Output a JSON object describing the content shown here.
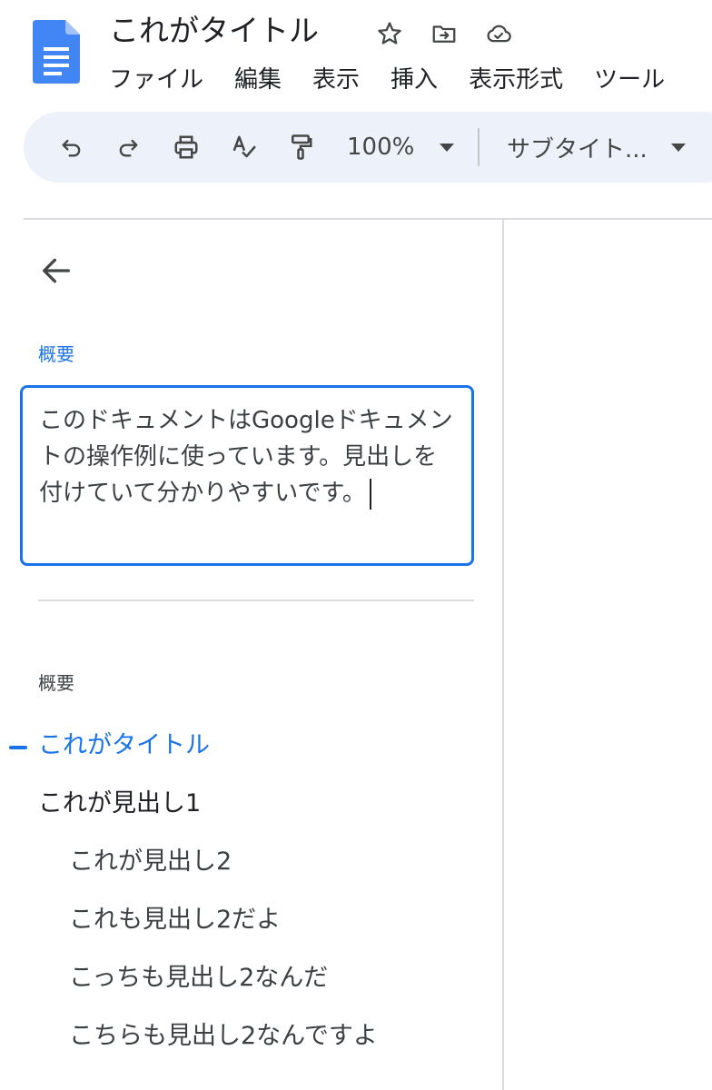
{
  "document": {
    "title": "これがタイトル"
  },
  "title_icons": [
    "star-icon",
    "move-to-folder-icon",
    "cloud-saved-icon"
  ],
  "menu": {
    "items": [
      "ファイル",
      "編集",
      "表示",
      "挿入",
      "表示形式",
      "ツール"
    ]
  },
  "toolbar": {
    "icons": [
      "undo-icon",
      "redo-icon",
      "print-icon",
      "spellcheck-icon",
      "paint-format-icon"
    ],
    "zoom": "100%",
    "style": "サブタイト..."
  },
  "sidebar": {
    "summary_label": "概要",
    "summary_text": "このドキュメントはGoogleドキュメントの操作例に使っています。見出しを付けていて分かりやすいです。",
    "outline_label": "概要",
    "outline": [
      {
        "text": "これがタイトル",
        "level": "title",
        "active": true
      },
      {
        "text": "これが見出し1",
        "level": 1
      },
      {
        "text": "これが見出し2",
        "level": 2
      },
      {
        "text": "これも見出し2だよ",
        "level": 2
      },
      {
        "text": "こっちも見出し2なんだ",
        "level": 2
      },
      {
        "text": "こちらも見出し2なんですよ",
        "level": 2
      }
    ]
  },
  "colors": {
    "accent": "#1a73e8",
    "doc_icon": "#4285f4",
    "toolbar_bg": "#edf2fa"
  }
}
